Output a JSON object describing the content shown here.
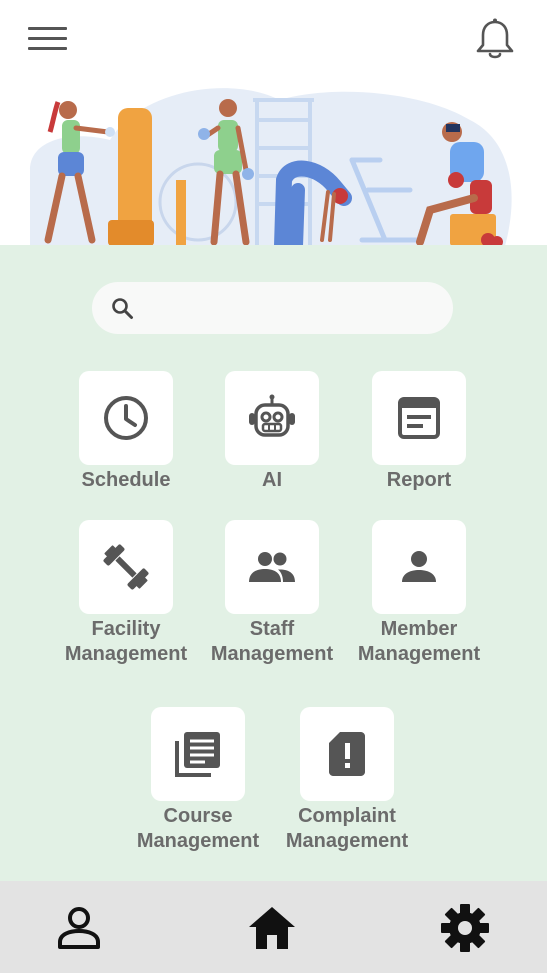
{
  "header": {
    "menu_icon": "hamburger-menu-icon",
    "notification_icon": "bell-icon"
  },
  "search": {
    "placeholder": "",
    "icon": "search-icon"
  },
  "tiles": [
    {
      "label": "Schedule",
      "icon": "clock-icon"
    },
    {
      "label": "AI",
      "icon": "robot-icon"
    },
    {
      "label": "Report",
      "icon": "report-icon"
    },
    {
      "label": "Facility\nManagement",
      "icon": "dumbbell-icon"
    },
    {
      "label": "Staff\nManagement",
      "icon": "people-icon"
    },
    {
      "label": "Member\nManagement",
      "icon": "person-icon"
    },
    {
      "label": "Course\nManagement",
      "icon": "library-books-icon"
    },
    {
      "label": "Complaint\nManagement",
      "icon": "complaint-sim-icon"
    }
  ],
  "bottom_nav": {
    "profile_icon": "person-outline-icon",
    "home_icon": "home-icon",
    "settings_icon": "gear-icon"
  },
  "colors": {
    "main_background": "#e2f1e5",
    "tile_background": "#ffffff",
    "tile_label": "#6b6b6b",
    "icon": "#555555",
    "bottom_bar": "#e3e3e3"
  }
}
